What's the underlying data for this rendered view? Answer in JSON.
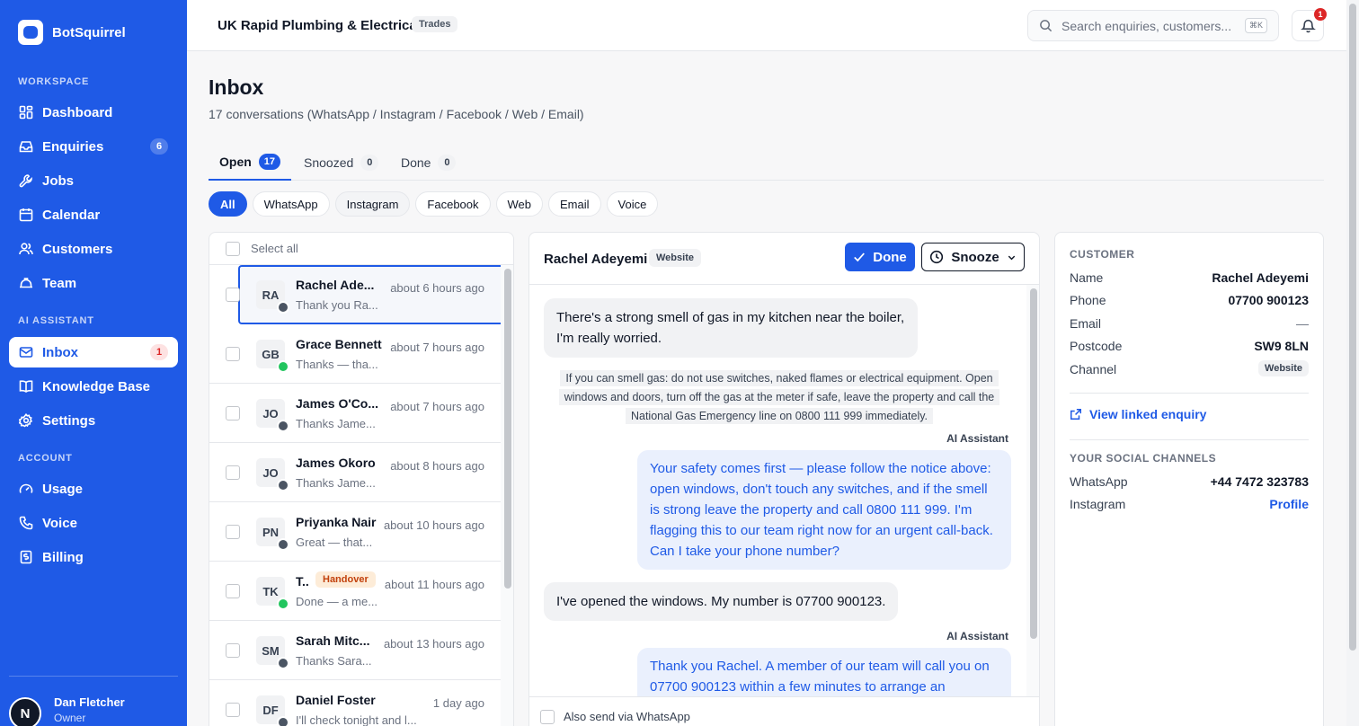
{
  "app": {
    "name": "BotSquirrel"
  },
  "sidebar": {
    "workspace_label": "WORKSPACE",
    "ai_label": "AI ASSISTANT",
    "account_label": "ACCOUNT",
    "items": [
      {
        "label": "Dashboard",
        "icon": "grid-icon"
      },
      {
        "label": "Enquiries",
        "icon": "inbox-tray-icon",
        "badge": "6"
      },
      {
        "label": "Jobs",
        "icon": "wrench-icon"
      },
      {
        "label": "Calendar",
        "icon": "calendar-icon"
      },
      {
        "label": "Customers",
        "icon": "users-icon"
      },
      {
        "label": "Team",
        "icon": "hard-hat-icon"
      },
      {
        "label": "Inbox",
        "icon": "mail-icon",
        "badge": "1",
        "active": true
      },
      {
        "label": "Knowledge Base",
        "icon": "book-icon"
      },
      {
        "label": "Settings",
        "icon": "gear-icon"
      },
      {
        "label": "Usage",
        "icon": "gauge-icon"
      },
      {
        "label": "Voice",
        "icon": "phone-icon"
      },
      {
        "label": "Billing",
        "icon": "receipt-icon"
      }
    ],
    "user": {
      "initial": "N",
      "name": "Dan Fletcher",
      "role": "Owner"
    }
  },
  "topbar": {
    "org_name": "UK Rapid Plumbing & Electrical",
    "org_tag": "Trades",
    "search_placeholder": "Search enquiries, customers...",
    "shortcut": "⌘K",
    "notifications": "1"
  },
  "page": {
    "title": "Inbox",
    "subtitle": "17 conversations (WhatsApp / Instagram / Facebook / Web / Email)"
  },
  "tabs": [
    {
      "label": "Open",
      "count": "17"
    },
    {
      "label": "Snoozed",
      "count": "0"
    },
    {
      "label": "Done",
      "count": "0"
    }
  ],
  "filters": [
    "All",
    "WhatsApp",
    "Instagram",
    "Facebook",
    "Web",
    "Email",
    "Voice"
  ],
  "list": {
    "select_all": "Select all",
    "rows": [
      {
        "initials": "RA",
        "name": "Rachel Ade...",
        "time": "about 6 hours ago",
        "preview": "Thank you Ra...",
        "channel": "web"
      },
      {
        "initials": "GB",
        "name": "Grace Bennett",
        "time": "about 7 hours ago",
        "preview": "Thanks — tha...",
        "channel": "whatsapp"
      },
      {
        "initials": "JO",
        "name": "James O'Co...",
        "time": "about 7 hours ago",
        "preview": "Thanks Jame...",
        "channel": "web"
      },
      {
        "initials": "JO",
        "name": "James Okoro",
        "time": "about 8 hours ago",
        "preview": "Thanks Jame...",
        "channel": "web"
      },
      {
        "initials": "PN",
        "name": "Priyanka Nair",
        "time": "about 10 hours ago",
        "preview": "Great — that...",
        "channel": "web"
      },
      {
        "initials": "TK",
        "name": "T..",
        "badge": "Handover",
        "time": "about 11 hours ago",
        "preview": "Done — a me...",
        "channel": "whatsapp"
      },
      {
        "initials": "SM",
        "name": "Sarah Mitc...",
        "time": "about 13 hours ago",
        "preview": "Thanks Sara...",
        "channel": "web"
      },
      {
        "initials": "DF",
        "name": "Daniel Foster",
        "time": "1 day ago",
        "preview": "I'll check tonight and l...",
        "channel": "web"
      }
    ]
  },
  "conversation": {
    "name": "Rachel Adeyemi",
    "channel_tag": "Website",
    "done_label": "Done",
    "snooze_label": "Snooze",
    "messages": {
      "m1": "There's a strong smell of gas in my kitchen near the boiler, I'm really worried.",
      "notice_1": "If you can smell gas: do not use switches, naked flames or electrical equipment. Open",
      "notice_2": "windows and doors, turn off the gas at the meter if safe, leave the property and call the",
      "notice_3": "National Gas Emergency line on 0800 111 999 immediately.",
      "ai_label": "AI Assistant",
      "m2": "Your safety comes first — please follow the notice above: open windows, don't touch any switches, and if the smell is strong leave the property and call 0800 111 999. I'm flagging this to our team right now for an urgent call-back. Can I take your phone number?",
      "m3": "I've opened the windows. My number is 07700 900123.",
      "m4": "Thank you Rachel. A member of our team will call you on 07700 900123 within a few minutes to arrange an"
    },
    "footer_label": "Also send via WhatsApp"
  },
  "customer": {
    "section": "CUSTOMER",
    "fields": [
      {
        "k": "Name",
        "v": "Rachel Adeyemi"
      },
      {
        "k": "Phone",
        "v": "07700 900123"
      },
      {
        "k": "Email",
        "v": "—"
      },
      {
        "k": "Postcode",
        "v": "SW9 8LN"
      },
      {
        "k": "Channel",
        "v": "Website"
      }
    ],
    "linked": "View linked enquiry",
    "social_section": "YOUR SOCIAL CHANNELS",
    "social": [
      {
        "k": "WhatsApp",
        "v": "+44 7472 323783"
      },
      {
        "k": "Instagram",
        "v": "Profile"
      }
    ]
  }
}
